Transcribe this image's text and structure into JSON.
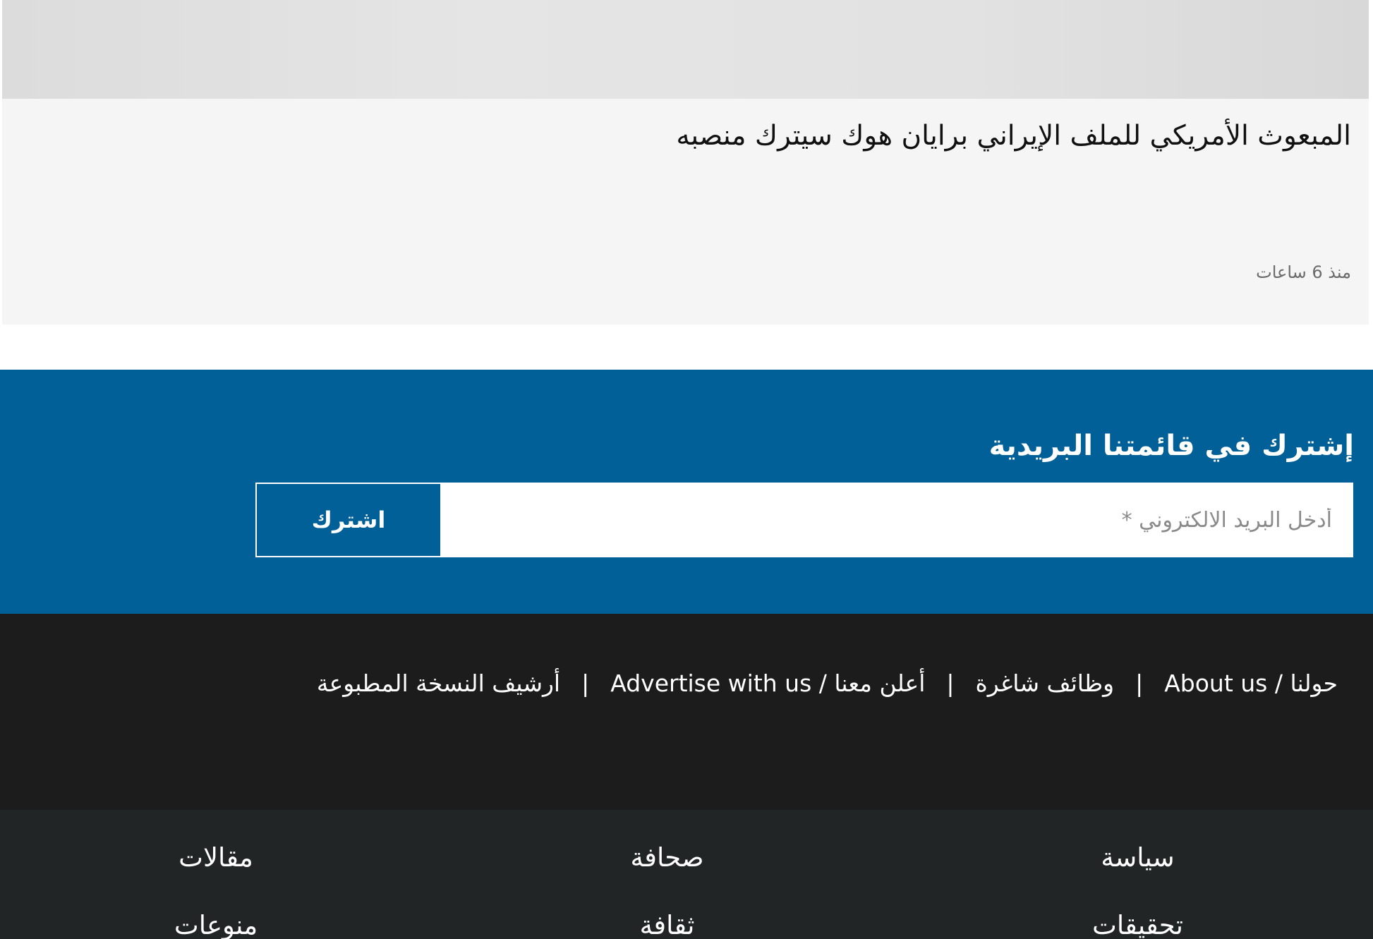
{
  "article": {
    "title": "المبعوث الأمريكي للملف الإيراني برايان هوك سيترك منصبه",
    "time": "منذ 6 ساعات"
  },
  "newsletter": {
    "title": "إشترك في قائمتنا البريدية",
    "email_placeholder": "أدخل البريد الالكتروني *",
    "email_value": "",
    "subscribe_label": "اشترك"
  },
  "footer_links": {
    "items": [
      {
        "label": "حولنا / About us"
      },
      {
        "label": "وظائف شاغرة"
      },
      {
        "label": "أعلن معنا / Advertise with us"
      },
      {
        "label": "أرشيف النسخة المطبوعة"
      }
    ],
    "separator": "|"
  },
  "categories": {
    "items": [
      {
        "label": "سياسة"
      },
      {
        "label": "صحافة"
      },
      {
        "label": "مقالات"
      },
      {
        "label": "تحقيقات"
      },
      {
        "label": "ثقافة"
      },
      {
        "label": "منوعات"
      }
    ]
  },
  "colors": {
    "newsletter_bg": "#026098",
    "footer_bg": "#1c1c1c",
    "categories_bg": "#222526",
    "card_bg": "#f5f5f5"
  }
}
